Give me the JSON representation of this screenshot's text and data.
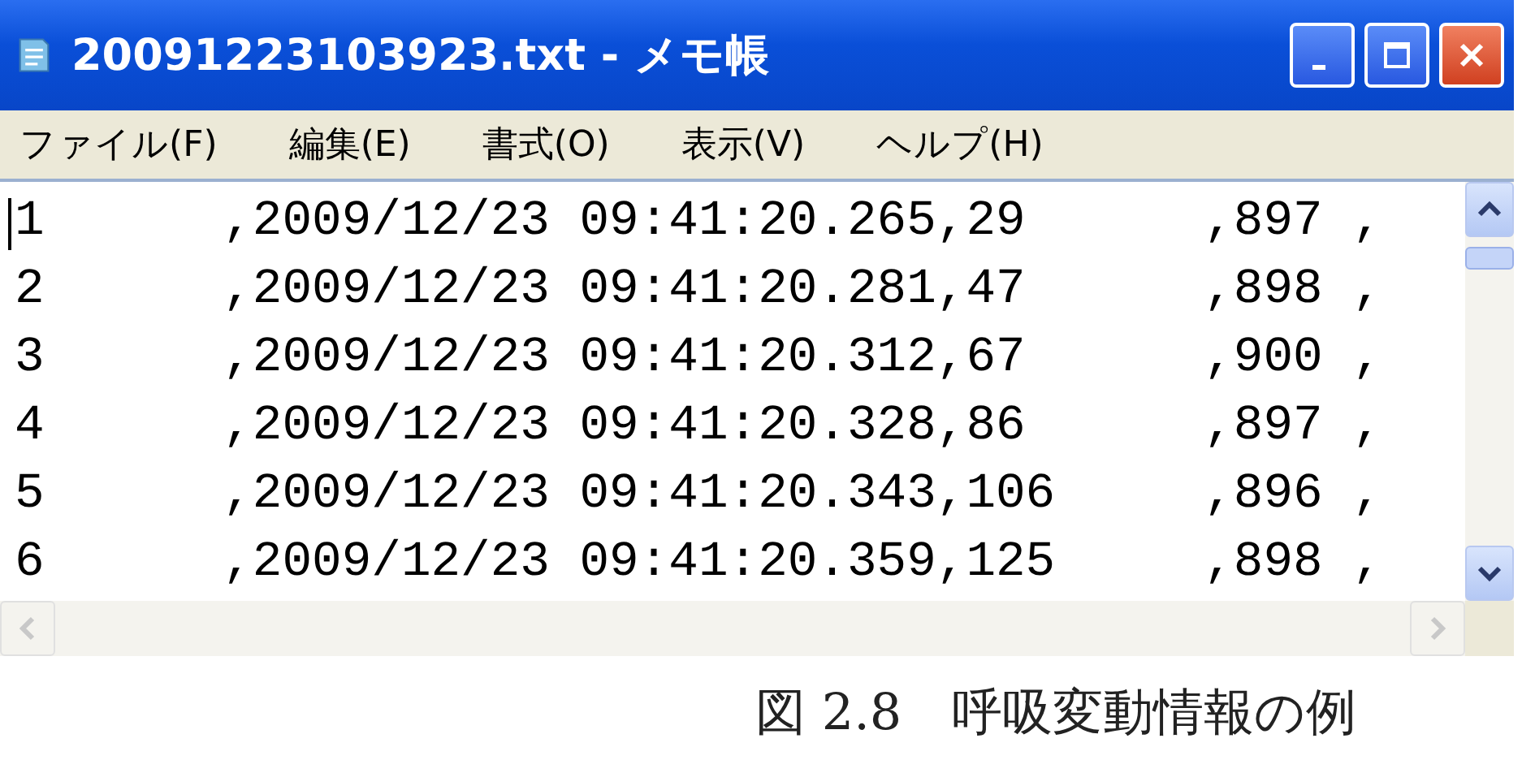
{
  "window": {
    "title": "20091223103923.txt - メモ帳"
  },
  "menu": [
    "ファイル(F)",
    "編集(E)",
    "書式(O)",
    "表示(V)",
    "ヘルプ(H)"
  ],
  "lines": [
    "1      ,2009/12/23 09:41:20.265,29      ,897 ,",
    "2      ,2009/12/23 09:41:20.281,47      ,898 ,",
    "3      ,2009/12/23 09:41:20.312,67      ,900 ,",
    "4      ,2009/12/23 09:41:20.328,86      ,897 ,",
    "5      ,2009/12/23 09:41:20.343,106     ,896 ,",
    "6      ,2009/12/23 09:41:20.359,125     ,898 ,"
  ],
  "caption": "図 2.8　呼吸変動情報の例"
}
